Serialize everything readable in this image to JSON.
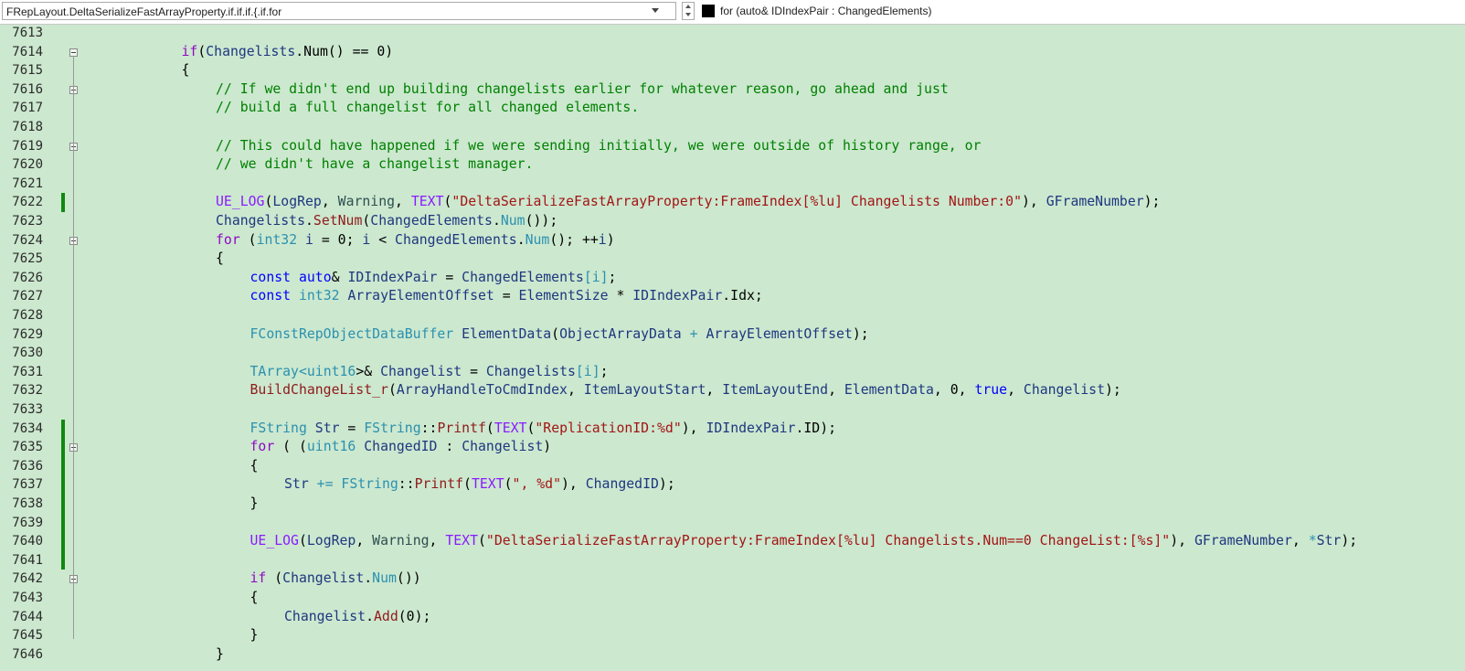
{
  "navbar": {
    "scope": "FRepLayout.DeltaSerializeFastArrayProperty.if.if.if.{.if.for",
    "member": "for (auto& IDIndexPair : ChangedElements)"
  },
  "colors": {
    "editor_background": "#cce8cf",
    "change_marker": "#108a10"
  },
  "lines": [
    {
      "n": "7613",
      "fold": false,
      "changed": false,
      "indent": 2,
      "tokens": []
    },
    {
      "n": "7614",
      "fold": true,
      "changed": false,
      "indent": 3,
      "tokens": [
        [
          "cf",
          "if"
        ],
        [
          "",
          "("
        ],
        [
          "id",
          "Changelists"
        ],
        [
          "",
          ".Num() == 0)"
        ]
      ]
    },
    {
      "n": "7615",
      "fold": false,
      "changed": false,
      "indent": 3,
      "tokens": [
        [
          "",
          "{"
        ]
      ]
    },
    {
      "n": "7616",
      "fold": true,
      "changed": false,
      "indent": 4,
      "tokens": [
        [
          "cm",
          "// If we didn't end up building changelists earlier for whatever reason, go ahead and just"
        ]
      ]
    },
    {
      "n": "7617",
      "fold": false,
      "changed": false,
      "indent": 4,
      "tokens": [
        [
          "cm",
          "// build a full changelist for all changed elements."
        ]
      ]
    },
    {
      "n": "7618",
      "fold": false,
      "changed": false,
      "indent": 4,
      "tokens": []
    },
    {
      "n": "7619",
      "fold": true,
      "changed": false,
      "indent": 4,
      "tokens": [
        [
          "cm",
          "// This could have happened if we were sending initially, we were outside of history range, or"
        ]
      ]
    },
    {
      "n": "7620",
      "fold": false,
      "changed": false,
      "indent": 4,
      "tokens": [
        [
          "cm",
          "// we didn't have a changelist manager."
        ]
      ]
    },
    {
      "n": "7621",
      "fold": false,
      "changed": false,
      "indent": 4,
      "tokens": []
    },
    {
      "n": "7622",
      "fold": false,
      "changed": true,
      "indent": 4,
      "tokens": [
        [
          "mc",
          "UE_LOG"
        ],
        [
          "",
          "("
        ],
        [
          "id",
          "LogRep"
        ],
        [
          "",
          ", "
        ],
        [
          "en",
          "Warning"
        ],
        [
          "",
          ", "
        ],
        [
          "mc",
          "TEXT"
        ],
        [
          "",
          "("
        ],
        [
          "st",
          "\"DeltaSerializeFastArrayProperty:FrameIndex[%lu] Changelists Number:0\""
        ],
        [
          "",
          "), "
        ],
        [
          "id",
          "GFrameNumber"
        ],
        [
          "",
          ");"
        ]
      ]
    },
    {
      "n": "7623",
      "fold": false,
      "changed": false,
      "indent": 4,
      "tokens": [
        [
          "id",
          "Changelists"
        ],
        [
          "",
          "."
        ],
        [
          "fnr",
          "SetNum"
        ],
        [
          "",
          "("
        ],
        [
          "id",
          "ChangedElements"
        ],
        [
          "",
          "."
        ],
        [
          "ty",
          "Num"
        ],
        [
          "",
          "());"
        ]
      ]
    },
    {
      "n": "7624",
      "fold": true,
      "changed": false,
      "indent": 4,
      "tokens": [
        [
          "cf",
          "for"
        ],
        [
          "",
          " ("
        ],
        [
          "ty",
          "int32"
        ],
        [
          "",
          ""
        ],
        [
          "id",
          " i"
        ],
        [
          "",
          " = 0; "
        ],
        [
          "id",
          "i"
        ],
        [
          "",
          " < "
        ],
        [
          "id",
          "ChangedElements"
        ],
        [
          "",
          "."
        ],
        [
          "ty",
          "Num"
        ],
        [
          "",
          "(); ++"
        ],
        [
          "id",
          "i"
        ],
        [
          "",
          ")"
        ]
      ]
    },
    {
      "n": "7625",
      "fold": false,
      "changed": false,
      "indent": 4,
      "tokens": [
        [
          "",
          "{"
        ]
      ]
    },
    {
      "n": "7626",
      "fold": false,
      "changed": false,
      "indent": 5,
      "tokens": [
        [
          "kw",
          "const"
        ],
        [
          "",
          " "
        ],
        [
          "kw",
          "auto"
        ],
        [
          "",
          "& "
        ],
        [
          "id",
          "IDIndexPair"
        ],
        [
          "",
          " = "
        ],
        [
          "id",
          "ChangedElements"
        ],
        [
          "ty",
          "[i]"
        ],
        [
          "",
          ";"
        ]
      ]
    },
    {
      "n": "7627",
      "fold": false,
      "changed": false,
      "indent": 5,
      "tokens": [
        [
          "kw",
          "const"
        ],
        [
          "",
          " "
        ],
        [
          "ty",
          "int32"
        ],
        [
          "",
          " "
        ],
        [
          "id",
          "ArrayElementOffset"
        ],
        [
          "",
          " = "
        ],
        [
          "id",
          "ElementSize"
        ],
        [
          "",
          " * "
        ],
        [
          "id",
          "IDIndexPair"
        ],
        [
          "",
          ".Idx;"
        ]
      ]
    },
    {
      "n": "7628",
      "fold": false,
      "changed": false,
      "indent": 5,
      "tokens": []
    },
    {
      "n": "7629",
      "fold": false,
      "changed": false,
      "indent": 5,
      "tokens": [
        [
          "ty",
          "FConstRepObjectDataBuffer"
        ],
        [
          "",
          " "
        ],
        [
          "id",
          "ElementData"
        ],
        [
          "",
          "("
        ],
        [
          "id",
          "ObjectArrayData"
        ],
        [
          "",
          " "
        ],
        [
          "ty",
          "+"
        ],
        [
          "",
          " "
        ],
        [
          "id",
          "ArrayElementOffset"
        ],
        [
          "",
          ");"
        ]
      ]
    },
    {
      "n": "7630",
      "fold": false,
      "changed": false,
      "indent": 5,
      "tokens": []
    },
    {
      "n": "7631",
      "fold": false,
      "changed": false,
      "indent": 5,
      "tokens": [
        [
          "ty",
          "TArray"
        ],
        [
          "ty",
          "<"
        ],
        [
          "ty",
          "uint16"
        ],
        [
          "",
          "",
          ""
        ],
        [
          "",
          ">& "
        ],
        [
          "id",
          "Changelist"
        ],
        [
          "",
          " = "
        ],
        [
          "id",
          "Changelists"
        ],
        [
          "ty",
          "[i]"
        ],
        [
          "",
          ";"
        ]
      ]
    },
    {
      "n": "7632",
      "fold": false,
      "changed": false,
      "indent": 5,
      "tokens": [
        [
          "fnr",
          "BuildChangeList_r"
        ],
        [
          "",
          "("
        ],
        [
          "id",
          "ArrayHandleToCmdIndex"
        ],
        [
          "",
          ", "
        ],
        [
          "id",
          "ItemLayoutStart"
        ],
        [
          "",
          ", "
        ],
        [
          "id",
          "ItemLayoutEnd"
        ],
        [
          "",
          ", "
        ],
        [
          "id",
          "ElementData"
        ],
        [
          "",
          ", 0, "
        ],
        [
          "kw",
          "true"
        ],
        [
          "",
          ", "
        ],
        [
          "id",
          "Changelist"
        ],
        [
          "",
          ");"
        ]
      ]
    },
    {
      "n": "7633",
      "fold": false,
      "changed": false,
      "indent": 5,
      "tokens": []
    },
    {
      "n": "7634",
      "fold": false,
      "changed": true,
      "indent": 5,
      "tokens": [
        [
          "ty",
          "FString"
        ],
        [
          "",
          " "
        ],
        [
          "id",
          "Str"
        ],
        [
          "",
          " = "
        ],
        [
          "ty",
          "FString"
        ],
        [
          "",
          "::"
        ],
        [
          "fnr",
          "Printf"
        ],
        [
          "",
          "("
        ],
        [
          "mc",
          "TEXT"
        ],
        [
          "",
          "("
        ],
        [
          "st",
          "\"ReplicationID:%d\""
        ],
        [
          "",
          "), "
        ],
        [
          "id",
          "IDIndexPair"
        ],
        [
          "",
          ".ID);"
        ]
      ]
    },
    {
      "n": "7635",
      "fold": true,
      "changed": true,
      "indent": 5,
      "tokens": [
        [
          "cf",
          "for"
        ],
        [
          "",
          "",
          " ("
        ],
        [
          "",
          "",
          " ("
        ],
        [
          "ty",
          "uint16"
        ],
        [
          "",
          " "
        ],
        [
          "id",
          "ChangedID"
        ],
        [
          "",
          " : "
        ],
        [
          "id",
          "Changelist"
        ],
        [
          "",
          ")"
        ]
      ]
    },
    {
      "n": "7636",
      "fold": false,
      "changed": true,
      "indent": 5,
      "tokens": [
        [
          "",
          "{"
        ]
      ]
    },
    {
      "n": "7637",
      "fold": false,
      "changed": true,
      "indent": 6,
      "tokens": [
        [
          "id",
          "Str"
        ],
        [
          "",
          " "
        ],
        [
          "ty",
          "+="
        ],
        [
          "",
          " "
        ],
        [
          "ty",
          "FString"
        ],
        [
          "",
          "::"
        ],
        [
          "fnr",
          "Printf"
        ],
        [
          "",
          "("
        ],
        [
          "mc",
          "TEXT"
        ],
        [
          "",
          "("
        ],
        [
          "st",
          "\", %d\""
        ],
        [
          "",
          "), "
        ],
        [
          "id",
          "ChangedID"
        ],
        [
          "",
          ");"
        ]
      ]
    },
    {
      "n": "7638",
      "fold": false,
      "changed": true,
      "indent": 5,
      "tokens": [
        [
          "",
          "}"
        ]
      ]
    },
    {
      "n": "7639",
      "fold": false,
      "changed": true,
      "indent": 5,
      "tokens": []
    },
    {
      "n": "7640",
      "fold": false,
      "changed": true,
      "indent": 5,
      "tokens": [
        [
          "mc",
          "UE_LOG"
        ],
        [
          "",
          "("
        ],
        [
          "id",
          "LogRep"
        ],
        [
          "",
          ", "
        ],
        [
          "en",
          "Warning"
        ],
        [
          "",
          ", "
        ],
        [
          "mc",
          "TEXT"
        ],
        [
          "",
          "("
        ],
        [
          "st",
          "\"DeltaSerializeFastArrayProperty:FrameIndex[%lu] Changelists.Num==0 ChangeList:[%s]\""
        ],
        [
          "",
          "), "
        ],
        [
          "id",
          "GFrameNumber"
        ],
        [
          "",
          ", "
        ],
        [
          "ty",
          "*"
        ],
        [
          "id",
          "Str"
        ],
        [
          "",
          ");"
        ]
      ]
    },
    {
      "n": "7641",
      "fold": false,
      "changed": true,
      "indent": 5,
      "tokens": []
    },
    {
      "n": "7642",
      "fold": true,
      "changed": false,
      "indent": 5,
      "tokens": [
        [
          "cf",
          "if"
        ],
        [
          "",
          " ("
        ],
        [
          "id",
          "Changelist"
        ],
        [
          "",
          "."
        ],
        [
          "ty",
          "Num"
        ],
        [
          "",
          "())"
        ]
      ]
    },
    {
      "n": "7643",
      "fold": false,
      "changed": false,
      "indent": 5,
      "tokens": [
        [
          "",
          "{"
        ]
      ]
    },
    {
      "n": "7644",
      "fold": false,
      "changed": false,
      "indent": 6,
      "tokens": [
        [
          "id",
          "Changelist"
        ],
        [
          "",
          "."
        ],
        [
          "fnr",
          "Add"
        ],
        [
          "",
          "(0);"
        ]
      ]
    },
    {
      "n": "7645",
      "fold": false,
      "changed": false,
      "indent": 5,
      "tokens": [
        [
          "",
          "}"
        ]
      ]
    },
    {
      "n": "7646",
      "fold": false,
      "changed": false,
      "indent": 4,
      "tokens": [
        [
          "",
          "}"
        ]
      ]
    }
  ]
}
